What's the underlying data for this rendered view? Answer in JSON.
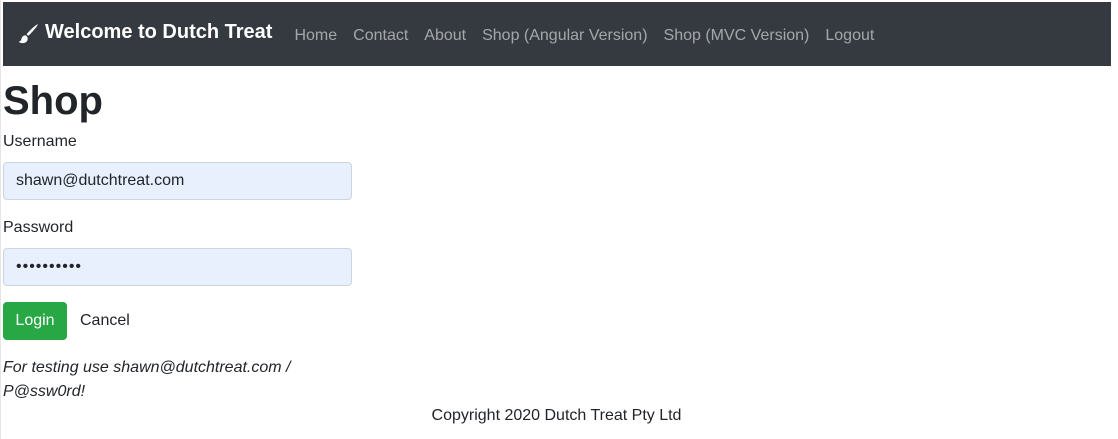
{
  "navbar": {
    "brand": "Welcome to Dutch Treat",
    "brand_icon": "paintbrush-icon",
    "links": [
      "Home",
      "Contact",
      "About",
      "Shop (Angular Version)",
      "Shop (MVC Version)",
      "Logout"
    ],
    "background": "#343a40"
  },
  "main": {
    "title": "Shop",
    "username": {
      "label": "Username",
      "value": "shawn@dutchtreat.com"
    },
    "password": {
      "label": "Password",
      "value": "••••••••••"
    },
    "login_label": "Login",
    "cancel_label": "Cancel",
    "hint_line1": "For testing use shawn@dutchtreat.com /",
    "hint_line2": "P@ssw0rd!"
  },
  "footer": {
    "copyright": "Copyright 2020 Dutch Treat Pty Ltd"
  },
  "colors": {
    "login_button": "#28a745",
    "input_autofill": "#e8f0fe"
  }
}
